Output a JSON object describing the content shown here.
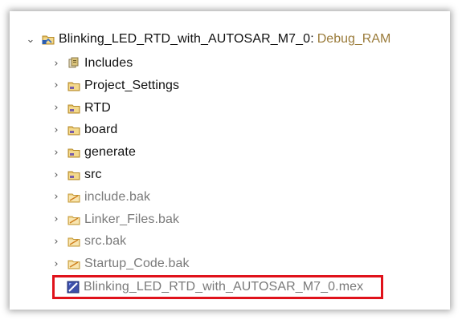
{
  "project": {
    "name": "Blinking_LED_RTD_with_AUTOSAR_M7_0",
    "config": "Debug_RAM",
    "separator": ":"
  },
  "items": [
    {
      "label": "Includes",
      "icon": "includes-icon",
      "dim": false
    },
    {
      "label": "Project_Settings",
      "icon": "source-folder-icon",
      "dim": false
    },
    {
      "label": "RTD",
      "icon": "source-folder-icon",
      "dim": false
    },
    {
      "label": "board",
      "icon": "source-folder-icon",
      "dim": false
    },
    {
      "label": "generate",
      "icon": "source-folder-icon",
      "dim": false
    },
    {
      "label": "src",
      "icon": "source-folder-icon",
      "dim": false
    },
    {
      "label": "include.bak",
      "icon": "excluded-folder-icon",
      "dim": true
    },
    {
      "label": "Linker_Files.bak",
      "icon": "excluded-folder-icon",
      "dim": true
    },
    {
      "label": "src.bak",
      "icon": "excluded-folder-icon",
      "dim": true
    },
    {
      "label": "Startup_Code.bak",
      "icon": "excluded-folder-icon",
      "dim": true
    }
  ],
  "mex_file": {
    "label": "Blinking_LED_RTD_with_AUTOSAR_M7_0.mex",
    "icon": "mex-file-icon"
  },
  "colors": {
    "highlight": "#e0121b",
    "decoration": "#9a7b3a",
    "dim_text": "#7a7a7a"
  }
}
